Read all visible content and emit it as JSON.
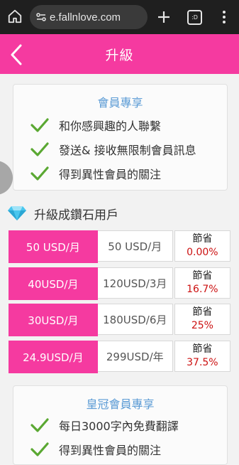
{
  "browser": {
    "url": "e.fallnlove.com",
    "tab_count_label": ":D"
  },
  "header": {
    "title": "升級"
  },
  "member_card": {
    "title": "會員專享",
    "perks": [
      "和你感興趣的人聯繫",
      "發送& 接收無限制會員訊息",
      "得到異性會員的關注"
    ]
  },
  "diamond": {
    "heading": "升級成鑽石用戶",
    "plans": [
      {
        "price": "50 USD/月",
        "total": "50 USD/月",
        "save_label": "節省",
        "save_pct": "0.00%"
      },
      {
        "price": "40USD/月",
        "total": "120USD/3月",
        "save_label": "節省",
        "save_pct": "16.7%"
      },
      {
        "price": "30USD/月",
        "total": "180USD/6月",
        "save_label": "節省",
        "save_pct": "25%"
      },
      {
        "price": "24.9USD/月",
        "total": "299USD/年",
        "save_label": "節省",
        "save_pct": "37.5%"
      }
    ]
  },
  "crown_card": {
    "title": "皇冠會員專享",
    "perks": [
      "每日3000字內免費翻譯",
      "得到異性會員的關注"
    ]
  },
  "colors": {
    "brand_pink": "#f53aa0",
    "check_green": "#5aa832",
    "title_blue": "#5b9bd5",
    "save_red": "#cc1111"
  }
}
